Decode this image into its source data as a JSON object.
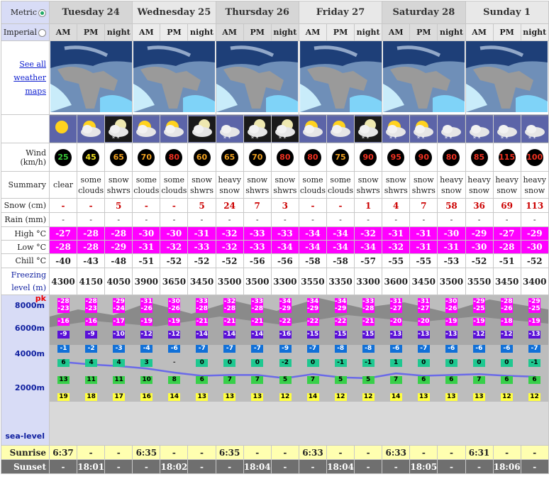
{
  "units": {
    "metric": "Metric",
    "imperial": "Imperial"
  },
  "days": [
    "Tuesday 24",
    "Wednesday 25",
    "Thursday 26",
    "Friday 27",
    "Saturday 28",
    "Sunday 1"
  ],
  "periods": [
    "AM",
    "PM",
    "night",
    "AM",
    "PM",
    "night",
    "AM",
    "PM",
    "night",
    "AM",
    "PM",
    "night",
    "AM",
    "PM",
    "night",
    "AM",
    "PM",
    "night"
  ],
  "maps_link": "See all weather maps",
  "labels": {
    "wind": "Wind (km/h)",
    "summary": "Summary",
    "snow": "Snow (cm)",
    "rain": "Rain (mm)",
    "high": "High °C",
    "low": "Low °C",
    "chill": "Chill °C",
    "freezing": "Freezing level (m)",
    "sunrise": "Sunrise",
    "sunset": "Sunset",
    "alt_8000": "8000m",
    "alt_6000": "6000m",
    "alt_4000": "4000m",
    "alt_2000": "2000m",
    "alt_sea": "sea-level",
    "pk": "pk"
  },
  "icons": [
    "sun-icon",
    "sun-cloud-icon",
    "moon-cloud-snow-icon",
    "sun-cloud-icon",
    "sun-cloud-icon",
    "moon-cloud-icon",
    "cloud-snow-icon",
    "moon-cloud-snow-icon",
    "moon-cloud-snow-icon",
    "sun-cloud-icon",
    "sun-cloud-icon",
    "moon-cloud-snow-icon",
    "sun-cloud-snow-icon",
    "sun-cloud-snow-icon",
    "cloud-snow-icon",
    "cloud-snow-icon",
    "cloud-snow-icon",
    "cloud-snow-icon"
  ],
  "wind": [
    "25",
    "45",
    "65",
    "70",
    "80",
    "60",
    "65",
    "70",
    "80",
    "80",
    "75",
    "90",
    "95",
    "90",
    "80",
    "85",
    "115",
    "100"
  ],
  "wind_colors": [
    "#37c837",
    "#f0e020",
    "#f0a020",
    "#f0a020",
    "#f03020",
    "#f0a020",
    "#f0a020",
    "#f0a020",
    "#f03020",
    "#f03020",
    "#f0a020",
    "#f03020",
    "#f03020",
    "#f03020",
    "#f03020",
    "#f03020",
    "#f03020",
    "#f03020"
  ],
  "summary": [
    [
      "clear",
      ""
    ],
    [
      "some",
      "clouds"
    ],
    [
      "snow",
      "shwrs"
    ],
    [
      "some",
      "clouds"
    ],
    [
      "some",
      "clouds"
    ],
    [
      "snow",
      "shwrs"
    ],
    [
      "heavy",
      "snow"
    ],
    [
      "snow",
      "shwrs"
    ],
    [
      "snow",
      "shwrs"
    ],
    [
      "some",
      "clouds"
    ],
    [
      "some",
      "clouds"
    ],
    [
      "snow",
      "shwrs"
    ],
    [
      "snow",
      "shwrs"
    ],
    [
      "snow",
      "shwrs"
    ],
    [
      "heavy",
      "snow"
    ],
    [
      "heavy",
      "snow"
    ],
    [
      "heavy",
      "snow"
    ],
    [
      "heavy",
      "snow"
    ]
  ],
  "snow": [
    "-",
    "-",
    "5",
    "-",
    "-",
    "5",
    "24",
    "7",
    "3",
    "-",
    "-",
    "1",
    "4",
    "7",
    "58",
    "36",
    "69",
    "113"
  ],
  "rain": [
    "-",
    "-",
    "-",
    "-",
    "-",
    "-",
    "-",
    "-",
    "-",
    "-",
    "-",
    "-",
    "-",
    "-",
    "-",
    "-",
    "-",
    "-"
  ],
  "high": [
    "-27",
    "-28",
    "-28",
    "-30",
    "-30",
    "-31",
    "-32",
    "-33",
    "-33",
    "-34",
    "-34",
    "-32",
    "-31",
    "-31",
    "-30",
    "-29",
    "-27",
    "-29"
  ],
  "low": [
    "-28",
    "-28",
    "-29",
    "-31",
    "-32",
    "-33",
    "-32",
    "-33",
    "-34",
    "-34",
    "-34",
    "-34",
    "-32",
    "-31",
    "-31",
    "-30",
    "-28",
    "-30"
  ],
  "chill": [
    "-40",
    "-43",
    "-48",
    "-51",
    "-52",
    "-52",
    "-52",
    "-56",
    "-56",
    "-58",
    "-58",
    "-57",
    "-55",
    "-55",
    "-53",
    "-52",
    "-51",
    "-52"
  ],
  "freezing": [
    "4300",
    "4150",
    "4050",
    "3900",
    "3650",
    "3450",
    "3500",
    "3500",
    "3300",
    "3550",
    "3350",
    "3300",
    "3600",
    "3450",
    "3500",
    "3550",
    "3450",
    "3400"
  ],
  "alt_rows": [
    [
      "-28",
      "-28",
      "-29",
      "-31",
      "-30",
      "-33",
      "-32",
      "-33",
      "-34",
      "-34",
      "-34",
      "-33",
      "-31",
      "-31",
      "-30",
      "-29",
      "-28",
      "-29"
    ],
    [
      "-23",
      "-23",
      "-24",
      "-26",
      "-26",
      "-28",
      "-28",
      "-28",
      "-29",
      "-29",
      "-29",
      "-28",
      "-27",
      "-27",
      "-26",
      "-25",
      "-26",
      "-25"
    ],
    [
      "-16",
      "-16",
      "-17",
      "-19",
      "-19",
      "-21",
      "-21",
      "-21",
      "-22",
      "-22",
      "-22",
      "-21",
      "-20",
      "-20",
      "-19",
      "-19",
      "-18",
      "-19"
    ],
    [
      "-9",
      "-9",
      "-10",
      "-12",
      "-12",
      "-14",
      "-14",
      "-14",
      "-16",
      "-15",
      "-15",
      "-15",
      "-13",
      "-13",
      "-13",
      "-12",
      "-12",
      "-13"
    ],
    [
      "-1",
      "-2",
      "-3",
      "-4",
      "-6",
      "-7",
      "-7",
      "-7",
      "-9",
      "-7",
      "-8",
      "-8",
      "-6",
      "-7",
      "-6",
      "-6",
      "-6",
      "-7"
    ],
    [
      "6",
      "4",
      "4",
      "3",
      "-",
      "0",
      "0",
      "0",
      "-2",
      "0",
      "-1",
      "-1",
      "1",
      "0",
      "0",
      "0",
      "0",
      "-1"
    ],
    [
      "13",
      "11",
      "11",
      "10",
      "8",
      "6",
      "7",
      "7",
      "5",
      "7",
      "5",
      "5",
      "7",
      "6",
      "6",
      "7",
      "6",
      "6"
    ],
    [
      "19",
      "18",
      "17",
      "16",
      "14",
      "13",
      "13",
      "13",
      "12",
      "14",
      "12",
      "12",
      "14",
      "13",
      "13",
      "13",
      "12",
      "12"
    ]
  ],
  "sunrise": [
    "6:37",
    "-",
    "-",
    "6:35",
    "-",
    "-",
    "6:35",
    "-",
    "-",
    "6:33",
    "-",
    "-",
    "6:33",
    "-",
    "-",
    "6:31",
    "-",
    "-"
  ],
  "sunset": [
    "-",
    "18:01",
    "-",
    "-",
    "18:02",
    "-",
    "-",
    "18:04",
    "-",
    "-",
    "18:04",
    "-",
    "-",
    "18:05",
    "-",
    "-",
    "18:06",
    "-"
  ],
  "colors": {
    "pink": "#ff00ff",
    "sidebar": "#d8dcf6",
    "sunrise": "#ffffb0",
    "sunset": "#6f6f6f",
    "freezing_line": "#6a6ae8"
  }
}
